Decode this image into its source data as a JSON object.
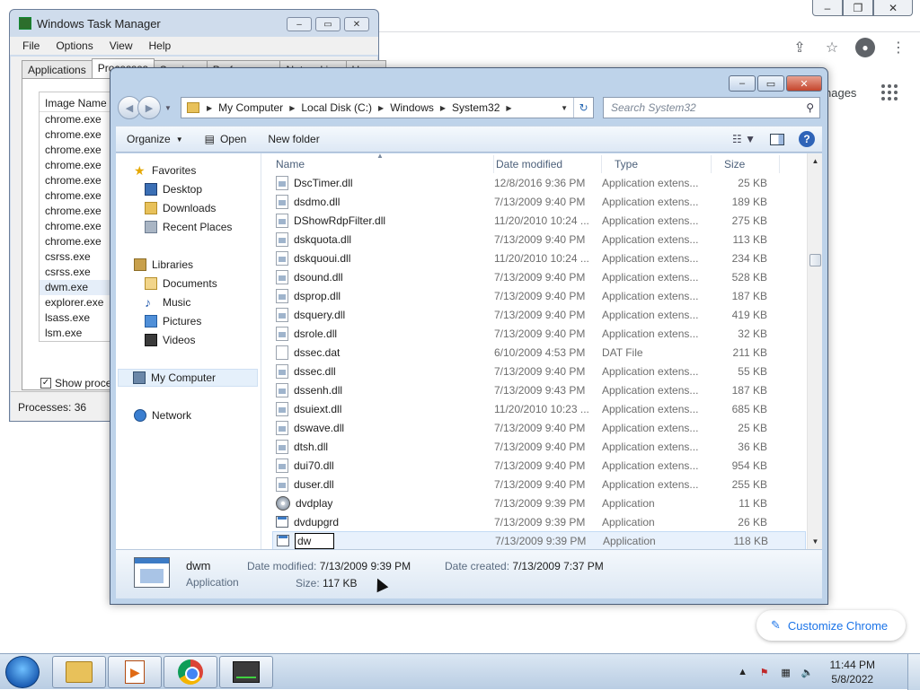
{
  "chrome": {
    "controls": {
      "minimize": "–",
      "restore": "❐",
      "close": "✕"
    },
    "images_label": "nages",
    "customize_label": "Customize Chrome"
  },
  "taskman": {
    "title": "Windows Task Manager",
    "menu": [
      "File",
      "Options",
      "View",
      "Help"
    ],
    "tabs": [
      "Applications",
      "Processes",
      "Services",
      "Performance",
      "Networking",
      "Users"
    ],
    "active_tab": "Processes",
    "column_header": "Image Name",
    "processes": [
      "chrome.exe",
      "chrome.exe",
      "chrome.exe",
      "chrome.exe",
      "chrome.exe",
      "chrome.exe",
      "chrome.exe",
      "chrome.exe",
      "chrome.exe",
      "csrss.exe",
      "csrss.exe",
      "dwm.exe",
      "explorer.exe",
      "lsass.exe",
      "lsm.exe"
    ],
    "selected_process": "dwm.exe",
    "show_processes_label": "Show process",
    "status": "Processes: 36"
  },
  "explorer": {
    "breadcrumb": [
      "My Computer",
      "Local Disk (C:)",
      "Windows",
      "System32"
    ],
    "search_placeholder": "Search System32",
    "toolbar": {
      "organize": "Organize",
      "open": "Open",
      "new_folder": "New folder"
    },
    "nav": {
      "favorites": "Favorites",
      "desktop": "Desktop",
      "downloads": "Downloads",
      "recent": "Recent Places",
      "libraries": "Libraries",
      "documents": "Documents",
      "music": "Music",
      "pictures": "Pictures",
      "videos": "Videos",
      "computer": "My Computer",
      "network": "Network"
    },
    "columns": {
      "name": "Name",
      "date": "Date modified",
      "type": "Type",
      "size": "Size"
    },
    "files": [
      {
        "name": "DscTimer.dll",
        "date": "12/8/2016 9:36 PM",
        "type": "Application extens...",
        "size": "25 KB",
        "icon": "dll"
      },
      {
        "name": "dsdmo.dll",
        "date": "7/13/2009 9:40 PM",
        "type": "Application extens...",
        "size": "189 KB",
        "icon": "dll"
      },
      {
        "name": "DShowRdpFilter.dll",
        "date": "11/20/2010 10:24 ...",
        "type": "Application extens...",
        "size": "275 KB",
        "icon": "dll"
      },
      {
        "name": "dskquota.dll",
        "date": "7/13/2009 9:40 PM",
        "type": "Application extens...",
        "size": "113 KB",
        "icon": "dll"
      },
      {
        "name": "dskquoui.dll",
        "date": "11/20/2010 10:24 ...",
        "type": "Application extens...",
        "size": "234 KB",
        "icon": "dll"
      },
      {
        "name": "dsound.dll",
        "date": "7/13/2009 9:40 PM",
        "type": "Application extens...",
        "size": "528 KB",
        "icon": "dll"
      },
      {
        "name": "dsprop.dll",
        "date": "7/13/2009 9:40 PM",
        "type": "Application extens...",
        "size": "187 KB",
        "icon": "dll"
      },
      {
        "name": "dsquery.dll",
        "date": "7/13/2009 9:40 PM",
        "type": "Application extens...",
        "size": "419 KB",
        "icon": "dll"
      },
      {
        "name": "dsrole.dll",
        "date": "7/13/2009 9:40 PM",
        "type": "Application extens...",
        "size": "32 KB",
        "icon": "dll"
      },
      {
        "name": "dssec.dat",
        "date": "6/10/2009 4:53 PM",
        "type": "DAT File",
        "size": "211 KB",
        "icon": "dat"
      },
      {
        "name": "dssec.dll",
        "date": "7/13/2009 9:40 PM",
        "type": "Application extens...",
        "size": "55 KB",
        "icon": "dll"
      },
      {
        "name": "dssenh.dll",
        "date": "7/13/2009 9:43 PM",
        "type": "Application extens...",
        "size": "187 KB",
        "icon": "dll"
      },
      {
        "name": "dsuiext.dll",
        "date": "11/20/2010 10:23 ...",
        "type": "Application extens...",
        "size": "685 KB",
        "icon": "dll"
      },
      {
        "name": "dswave.dll",
        "date": "7/13/2009 9:40 PM",
        "type": "Application extens...",
        "size": "25 KB",
        "icon": "dll"
      },
      {
        "name": "dtsh.dll",
        "date": "7/13/2009 9:40 PM",
        "type": "Application extens...",
        "size": "36 KB",
        "icon": "dll"
      },
      {
        "name": "dui70.dll",
        "date": "7/13/2009 9:40 PM",
        "type": "Application extens...",
        "size": "954 KB",
        "icon": "dll"
      },
      {
        "name": "duser.dll",
        "date": "7/13/2009 9:40 PM",
        "type": "Application extens...",
        "size": "255 KB",
        "icon": "dll"
      },
      {
        "name": "dvdplay",
        "date": "7/13/2009 9:39 PM",
        "type": "Application",
        "size": "11 KB",
        "icon": "dvd"
      },
      {
        "name": "dvdupgrd",
        "date": "7/13/2009 9:39 PM",
        "type": "Application",
        "size": "26 KB",
        "icon": "app"
      },
      {
        "name": "dw",
        "date": "7/13/2009 9:39 PM",
        "type": "Application",
        "size": "118 KB",
        "icon": "app",
        "renaming": true
      }
    ],
    "details": {
      "name": "dwm",
      "type": "Application",
      "date_modified_label": "Date modified:",
      "date_modified": "7/13/2009 9:39 PM",
      "size_label": "Size:",
      "size": "117 KB",
      "date_created_label": "Date created:",
      "date_created": "7/13/2009 7:37 PM"
    }
  },
  "taskbar": {
    "time": "11:44 PM",
    "date": "5/8/2022"
  }
}
